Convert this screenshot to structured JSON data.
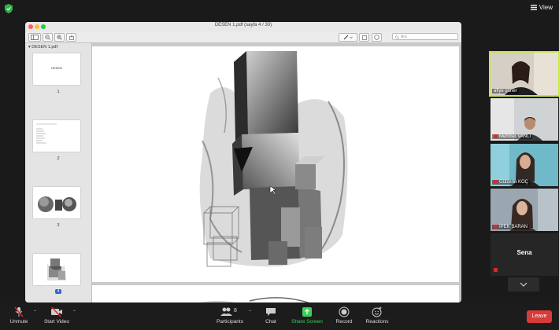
{
  "topbar": {
    "view_label": "View"
  },
  "pdf": {
    "title": "DESEN 1.pdf (sayfa 4 / 30)",
    "search_placeholder": "Ara",
    "sidebar_title": "DESEN 1.pdf",
    "thumb1_text": "DESEN",
    "thumbnails": [
      "1",
      "2",
      "3",
      "4"
    ],
    "current_page_index": 4
  },
  "participants": [
    {
      "name": "afiye güner",
      "active": true,
      "muted": false
    },
    {
      "name": "Mehmet VANLI",
      "active": false,
      "muted": true
    },
    {
      "name": "Gülzerin KOÇ",
      "active": false,
      "muted": true
    },
    {
      "name": "İPEK BARAN",
      "active": false,
      "muted": true
    },
    {
      "name": "Sena",
      "active": false,
      "muted": true
    }
  ],
  "toolbar": {
    "unmute": "Unmute",
    "start_video": "Start Video",
    "participants": "Participants",
    "participants_count": "8",
    "chat": "Chat",
    "share_screen": "Share Screen",
    "record": "Record",
    "reactions": "Reactions",
    "leave": "Leave"
  },
  "colors": {
    "active_speaker": "#c6e44a",
    "share_green": "#3ccf5a",
    "leave_red": "#d83b3b",
    "mic_off_red": "#e02828"
  }
}
